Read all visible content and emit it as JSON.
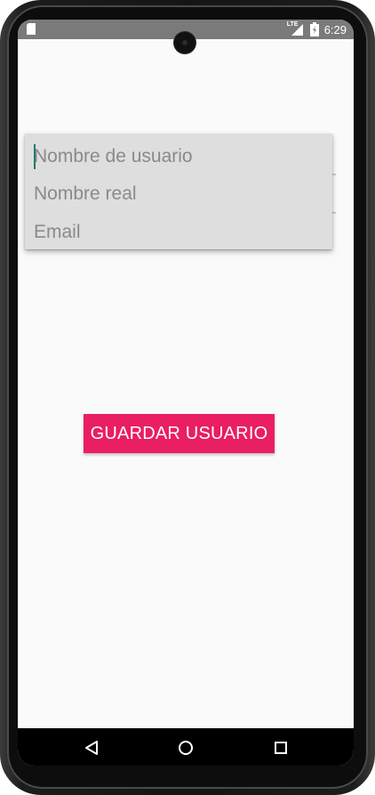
{
  "status_bar": {
    "time": "6:29",
    "network": "LTE",
    "icons": [
      "sd-card-icon",
      "signal-icon",
      "battery-charging-icon"
    ]
  },
  "form": {
    "username_placeholder": "Nombre de usuario",
    "realname_placeholder": "Nombre real",
    "email_placeholder": "Email"
  },
  "actions": {
    "save_label": "GUARDAR USUARIO"
  },
  "nav_bar": {
    "icons": [
      "back-icon",
      "home-icon",
      "recents-icon"
    ]
  },
  "colors": {
    "accent": "#e91e63",
    "cursor": "#0f7b6c",
    "status_bar": "#7a7a7a",
    "background": "#fafafa"
  }
}
